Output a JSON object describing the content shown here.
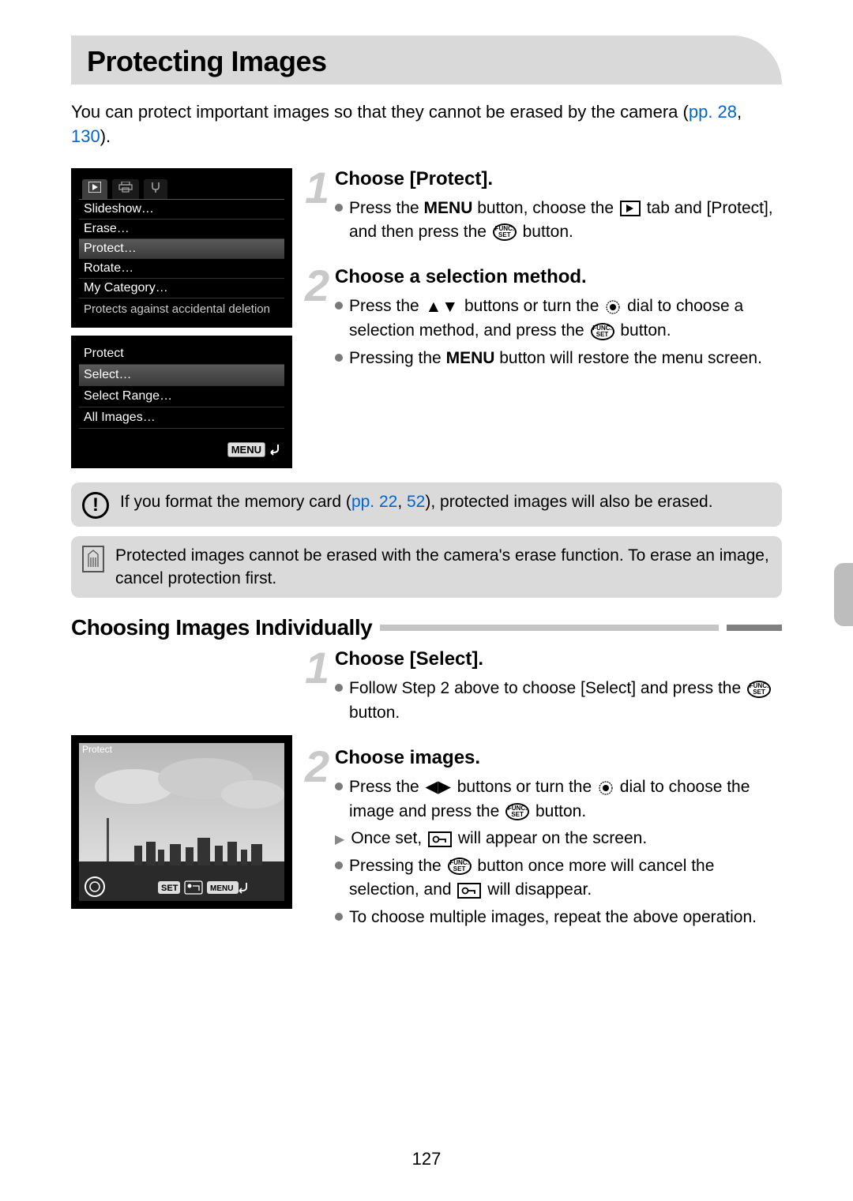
{
  "title": "Protecting Images",
  "intro_1": "You can protect important images so that they cannot be erased by the camera (",
  "intro_link1": "pp. 28",
  "intro_sep": ", ",
  "intro_link2": "130",
  "intro_2": ").",
  "lcd1": {
    "items": [
      "Slideshow…",
      "Erase…",
      "Protect…",
      "Rotate…",
      "My Category…"
    ],
    "hint": "Protects against accidental deletion"
  },
  "lcd2": {
    "title": "Protect",
    "items": [
      "Select…",
      "Select Range…",
      "All Images…"
    ],
    "menu": "MENU"
  },
  "step1": {
    "title": "Choose [Protect].",
    "b1a": "Press the ",
    "b1b": " button, choose the ",
    "b1c": " tab and [Protect], and then press the ",
    "b1d": " button."
  },
  "step2": {
    "title": "Choose a selection method.",
    "b1a": "Press the ",
    "b1b": " buttons or turn the ",
    "b1c": " dial to choose a selection method, and press the ",
    "b1d": " button.",
    "b2a": "Pressing the ",
    "b2b": " button will restore the menu screen."
  },
  "note1a": "If you format the memory card (",
  "note1_link1": "pp. 22",
  "note1_sep": ", ",
  "note1_link2": "52",
  "note1b": "), protected images will also be erased.",
  "note2": "Protected images cannot be erased with the camera's erase function. To erase an image, cancel protection first.",
  "subheading": "Choosing Images Individually",
  "step3": {
    "title": "Choose [Select].",
    "b1a": "Follow Step 2 above to choose [Select] and press the ",
    "b1b": " button."
  },
  "step4": {
    "title": "Choose images.",
    "b1a": "Press the ",
    "b1b": " buttons or turn the ",
    "b1c": " dial to choose the image and press the ",
    "b1d": " button.",
    "b2a": "Once set, ",
    "b2b": " will appear on the screen.",
    "b3a": "Pressing the ",
    "b3b": " button once more will cancel the selection, and ",
    "b3c": " will disappear.",
    "b4": "To choose multiple images, repeat the above operation."
  },
  "photo": {
    "label": "Protect",
    "set": "SET",
    "menu": "MENU"
  },
  "icons": {
    "menu": "MENU",
    "func": "FUNC.",
    "set": "SET"
  },
  "page_num": "127"
}
